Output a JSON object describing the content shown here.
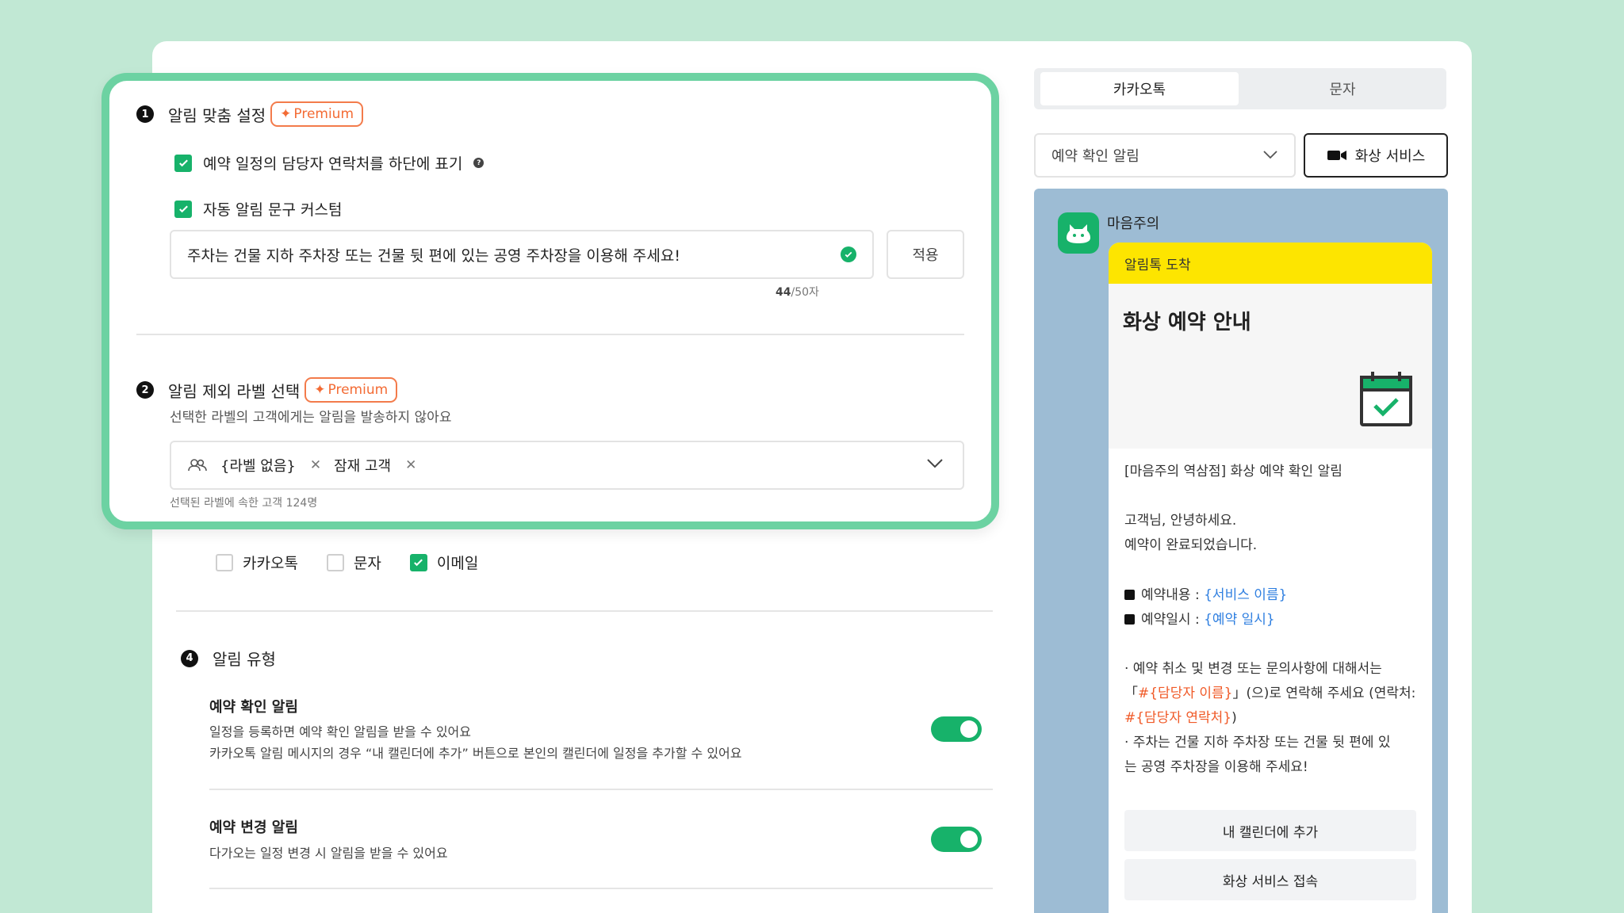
{
  "highlight": {
    "section1": {
      "number": "1",
      "title": "알림 맞춤 설정",
      "badge": "Premium",
      "option1": "예약 일정의 담당자 연락처를 하단에 표기",
      "option2": "자동 알림 문구 커스텀",
      "input_value": "주차는 건물 지하 주차장 또는 건물 뒷 편에 있는 공영 주차장을 이용해 주세요!",
      "apply": "적용",
      "count": "44",
      "count_suffix": "/50자"
    },
    "section2": {
      "number": "2",
      "title": "알림 제외 라벨 선택",
      "badge": "Premium",
      "subtitle": "선택한 라벨의 고객에게는 알림을 발송하지 않아요",
      "tags": [
        "{라벨 없음}",
        "잠재 고객"
      ],
      "caption": "선택된 라벨에 속한 고객 124명"
    }
  },
  "channels": {
    "options": [
      "카카오톡",
      "문자",
      "이메일"
    ],
    "checked": [
      false,
      false,
      true
    ]
  },
  "section4": {
    "number": "4",
    "title": "알림 유형",
    "items": [
      {
        "title": "예약 확인 알림",
        "desc1": "일정을 등록하면 예약 확인 알림을 받을 수 있어요",
        "desc2": "카카오톡 알림 메시지의 경우 “내 캘린더에 추가” 버튼으로 본인의 캘린더에 일정을 추가할 수 있어요"
      },
      {
        "title": "예약 변경 알림",
        "desc1": "다가오는 일정 변경 시 알림을 받을 수 있어요"
      }
    ]
  },
  "preview": {
    "tabs": [
      "카카오톡",
      "문자"
    ],
    "select_value": "예약 확인 알림",
    "video_button": "화상 서비스",
    "sender": "마음주의",
    "bubble_header": "알림톡 도착",
    "hero_title": "화상 예약 안내",
    "line1": "[마음주의 역삼점] 화상 예약 확인 알림",
    "line2": "고객님, 안녕하세요.",
    "line3": "예약이 완료되었습니다.",
    "item1_label": "예약내용 : ",
    "item1_var": "{서비스 이름}",
    "item2_label": "예약일시 : ",
    "item2_var": "{예약 일시}",
    "note1": "· 예약 취소 및 변경 또는 문의사항에 대해서는",
    "note2_open": "「",
    "note2_var": "#{담당자 이름}",
    "note2_rest": "」(으)로 연락해 주세요 (연락처:",
    "note3_var": "#{담당자 연락처}",
    "note3_close": ")",
    "note4": "· 주차는 건물 지하 주차장 또는 건물 뒷 편에 있",
    "note5": "는 공영 주차장을 이용해 주세요!",
    "button1": "내 캘린더에 추가",
    "button2": "화상 서비스 접속"
  },
  "colors": {
    "green": "#17b26a",
    "highlight_border": "#6cd2a2",
    "premium": "#f36b34",
    "kakao_yellow": "#fde500",
    "phone_bg": "#9dbcd4"
  }
}
